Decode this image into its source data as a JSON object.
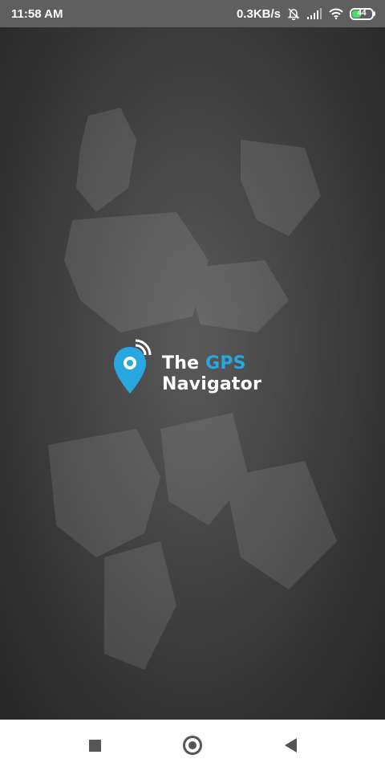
{
  "status_bar": {
    "time": "11:58 AM",
    "network_speed": "0.3KB/s",
    "battery_level": "44",
    "icons": [
      "silent-bell-icon",
      "signal-bars-icon",
      "wifi-icon",
      "battery-icon"
    ]
  },
  "splash": {
    "logo": {
      "line1_main": "The",
      "line1_accent": "GPS",
      "line2": "Navigator",
      "icon": "location-pin-signal-icon"
    },
    "background": "world-map-texture"
  },
  "nav_bar": {
    "icons": [
      "recents-square-icon",
      "home-circle-icon",
      "back-triangle-icon"
    ]
  },
  "colors": {
    "accent": "#29a8e0",
    "status_bar": "#5f5f5f",
    "battery_fill": "#4cd964",
    "nav_bar": "#ffffff",
    "nav_icon": "#555555"
  }
}
